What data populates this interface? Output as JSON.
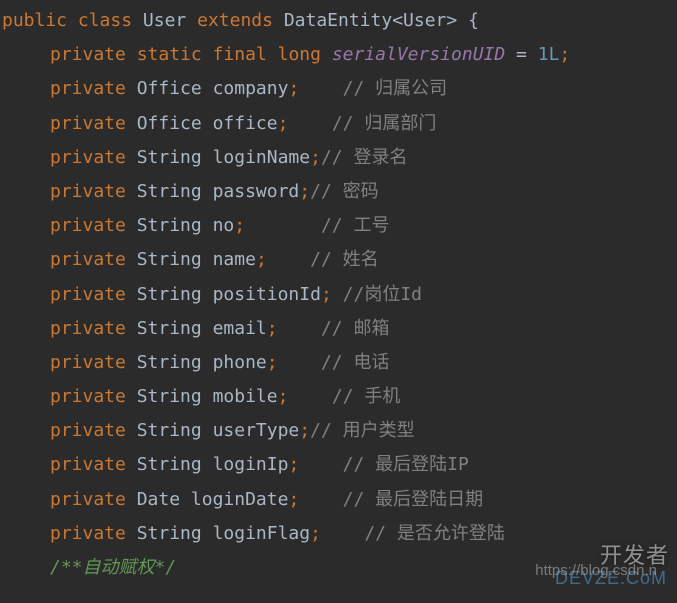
{
  "class_decl": {
    "modifiers": [
      "public",
      "class"
    ],
    "name": "User",
    "extends_kw": "extends",
    "base": "DataEntity",
    "generic": "User",
    "brace": "{"
  },
  "serial_line": {
    "modifiers": [
      "private",
      "static",
      "final"
    ],
    "type": "long",
    "name": "serialVersionUID",
    "eq": "=",
    "value": "1L",
    "semi": ";"
  },
  "fields": [
    {
      "mod": "private",
      "type": "Office",
      "name": "company",
      "semi": ";",
      "gap": "    ",
      "comment": "// 归属公司"
    },
    {
      "mod": "private",
      "type": "Office",
      "name": "office",
      "semi": ";",
      "gap": "    ",
      "comment": "// 归属部门"
    },
    {
      "mod": "private",
      "type": "String",
      "name": "loginName",
      "semi": ";",
      "gap": "",
      "comment": "// 登录名"
    },
    {
      "mod": "private",
      "type": "String",
      "name": "password",
      "semi": ";",
      "gap": "",
      "comment": "// 密码"
    },
    {
      "mod": "private",
      "type": "String",
      "name": "no",
      "semi": ";",
      "gap": "       ",
      "comment": "// 工号"
    },
    {
      "mod": "private",
      "type": "String",
      "name": "name",
      "semi": ";",
      "gap": "    ",
      "comment": "// 姓名"
    },
    {
      "mod": "private",
      "type": "String",
      "name": "positionId",
      "semi": ";",
      "gap": " ",
      "comment": "//岗位Id"
    },
    {
      "mod": "private",
      "type": "String",
      "name": "email",
      "semi": ";",
      "gap": "    ",
      "comment": "// 邮箱"
    },
    {
      "mod": "private",
      "type": "String",
      "name": "phone",
      "semi": ";",
      "gap": "    ",
      "comment": "// 电话"
    },
    {
      "mod": "private",
      "type": "String",
      "name": "mobile",
      "semi": ";",
      "gap": "    ",
      "comment": "// 手机"
    },
    {
      "mod": "private",
      "type": "String",
      "name": "userType",
      "semi": ";",
      "gap": "",
      "comment": "// 用户类型"
    },
    {
      "mod": "private",
      "type": "String",
      "name": "loginIp",
      "semi": ";",
      "gap": "    ",
      "comment": "// 最后登陆IP"
    },
    {
      "mod": "private",
      "type": "Date",
      "name": "loginDate",
      "semi": ";",
      "gap": "    ",
      "comment": "// 最后登陆日期"
    },
    {
      "mod": "private",
      "type": "String",
      "name": "loginFlag",
      "semi": ";",
      "gap": "    ",
      "comment": "// 是否允许登陆"
    }
  ],
  "auto_comment": "/**自动赋权*/",
  "watermark": {
    "url": "https://blog.csdn.n",
    "brand": "开发者",
    "sub": "DEVZE.CoM"
  }
}
